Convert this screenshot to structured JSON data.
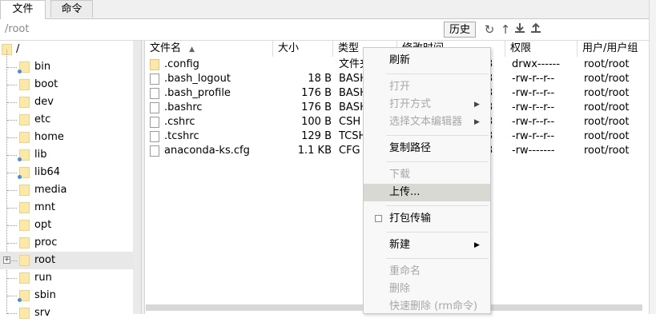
{
  "tabs": [
    {
      "label": "文件",
      "active": true
    },
    {
      "label": "命令",
      "active": false
    }
  ],
  "pathbar": {
    "path": "/root",
    "history_label": "历史",
    "icons": [
      "refresh-icon",
      "up-dir-icon",
      "download-icon",
      "upload-icon"
    ]
  },
  "tree": {
    "root_label": "/",
    "items": [
      {
        "label": "bin",
        "symlink": true
      },
      {
        "label": "boot",
        "symlink": false
      },
      {
        "label": "dev",
        "symlink": false
      },
      {
        "label": "etc",
        "symlink": false
      },
      {
        "label": "home",
        "symlink": false
      },
      {
        "label": "lib",
        "symlink": true
      },
      {
        "label": "lib64",
        "symlink": true
      },
      {
        "label": "media",
        "symlink": false
      },
      {
        "label": "mnt",
        "symlink": false
      },
      {
        "label": "opt",
        "symlink": false
      },
      {
        "label": "proc",
        "symlink": false
      },
      {
        "label": "root",
        "symlink": false,
        "selected": true,
        "expandable": true
      },
      {
        "label": "run",
        "symlink": false
      },
      {
        "label": "sbin",
        "symlink": true
      },
      {
        "label": "srv",
        "symlink": false
      }
    ],
    "expand_glyph": "+"
  },
  "file_columns": {
    "name": "文件名",
    "sort_glyph": "▲",
    "size": "大小",
    "type": "类型",
    "modified": "修改时间",
    "perm": "权限",
    "owner": "用户/用户组"
  },
  "files": [
    {
      "name": ".config",
      "size": "",
      "type": "文件夹",
      "mod": "3",
      "perm": "drwx------",
      "owner": "root/root",
      "icon": "folder"
    },
    {
      "name": ".bash_logout",
      "size": "18 B",
      "type": "BASH",
      "mod": "3",
      "perm": "-rw-r--r--",
      "owner": "root/root",
      "icon": "doc"
    },
    {
      "name": ".bash_profile",
      "size": "176 B",
      "type": "BASH",
      "mod": "3",
      "perm": "-rw-r--r--",
      "owner": "root/root",
      "icon": "doc"
    },
    {
      "name": ".bashrc",
      "size": "176 B",
      "type": "BASH",
      "mod": "3",
      "perm": "-rw-r--r--",
      "owner": "root/root",
      "icon": "doc"
    },
    {
      "name": ".cshrc",
      "size": "100 B",
      "type": "CSH",
      "mod": "3",
      "perm": "-rw-r--r--",
      "owner": "root/root",
      "icon": "doc"
    },
    {
      "name": ".tcshrc",
      "size": "129 B",
      "type": "TCSH",
      "mod": "3",
      "perm": "-rw-r--r--",
      "owner": "root/root",
      "icon": "doc"
    },
    {
      "name": "anaconda-ks.cfg",
      "size": "1.1 KB",
      "type": "CFG",
      "mod": "3",
      "perm": "-rw-------",
      "owner": "root/root",
      "icon": "doc"
    }
  ],
  "context_menu": {
    "refresh": "刷新",
    "open": "打开",
    "open_with": "打开方式",
    "choose_editor": "选择文本编辑器",
    "copy_path": "复制路径",
    "download": "下载",
    "upload": "上传...",
    "pack_transfer": "打包传输",
    "new": "新建",
    "rename": "重命名",
    "delete": "删除",
    "quick_delete": "快速删除 (rm命令)",
    "submenu_glyph": "▶"
  },
  "colors": {
    "hover": "#d9d9d3",
    "disabled_text": "#a7a7a7",
    "folder": "#fce8a8",
    "selected_row": "#e8e8e8"
  }
}
